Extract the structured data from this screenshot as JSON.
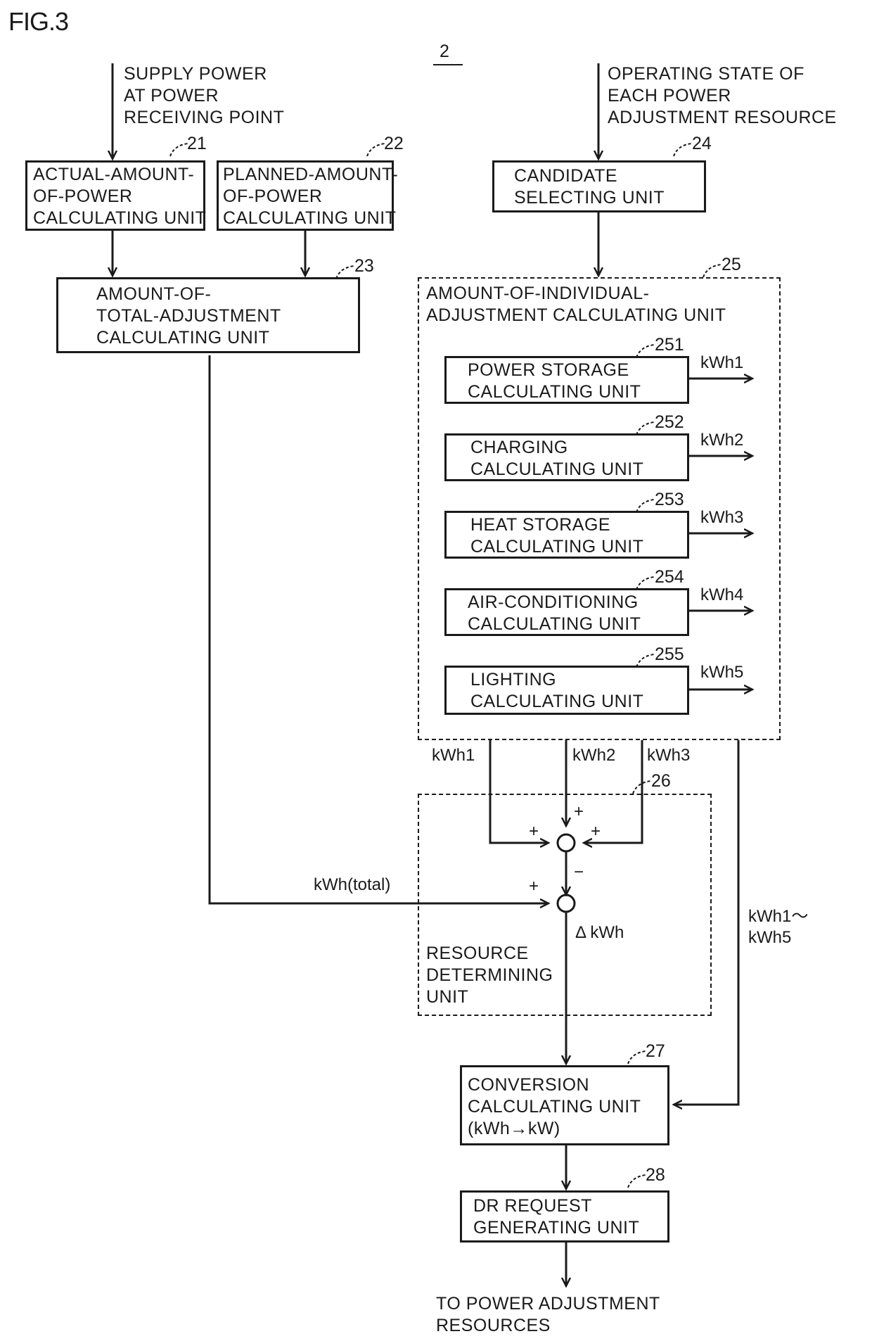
{
  "figure": {
    "label": "FIG.3",
    "system_ref": "2"
  },
  "inputs": {
    "supply_power": "SUPPLY POWER\nAT POWER\nRECEIVING POINT",
    "operating_state": "OPERATING STATE OF\nEACH POWER\nADJUSTMENT RESOURCE"
  },
  "units": {
    "u21": {
      "ref": "21",
      "label": "ACTUAL-AMOUNT-\nOF-POWER\nCALCULATING UNIT"
    },
    "u22": {
      "ref": "22",
      "label": "PLANNED-AMOUNT-\nOF-POWER\nCALCULATING UNIT"
    },
    "u23": {
      "ref": "23",
      "label": "AMOUNT-OF-\nTOTAL-ADJUSTMENT\nCALCULATING UNIT"
    },
    "u24": {
      "ref": "24",
      "label": "CANDIDATE\nSELECTING UNIT"
    },
    "u25": {
      "ref": "25",
      "label": "AMOUNT-OF-INDIVIDUAL-\nADJUSTMENT CALCULATING UNIT"
    },
    "u26": {
      "ref": "26",
      "label": "RESOURCE\nDETERMINING\nUNIT"
    },
    "u27": {
      "ref": "27",
      "label": "CONVERSION\nCALCULATING UNIT\n(kWh→kW)"
    },
    "u28": {
      "ref": "28",
      "label": "DR REQUEST\nGENERATING UNIT"
    }
  },
  "sub_units": [
    {
      "ref": "251",
      "label": "POWER STORAGE\nCALCULATING UNIT",
      "output": "kWh1"
    },
    {
      "ref": "252",
      "label": "CHARGING\nCALCULATING UNIT",
      "output": "kWh2"
    },
    {
      "ref": "253",
      "label": "HEAT STORAGE\nCALCULATING UNIT",
      "output": "kWh3"
    },
    {
      "ref": "254",
      "label": "AIR-CONDITIONING\nCALCULATING UNIT",
      "output": "kWh4"
    },
    {
      "ref": "255",
      "label": "LIGHTING\nCALCULATING UNIT",
      "output": "kWh5"
    }
  ],
  "signals": {
    "kwh1": "kWh1",
    "kwh2": "kWh2",
    "kwh3": "kWh3",
    "kwh_total": "kWh(total)",
    "delta_kwh": "Δ kWh",
    "kwh_range": "kWh1〜\nkWh5",
    "plus": "+",
    "minus": "−"
  },
  "output": {
    "label": "TO POWER ADJUSTMENT\nRESOURCES"
  }
}
